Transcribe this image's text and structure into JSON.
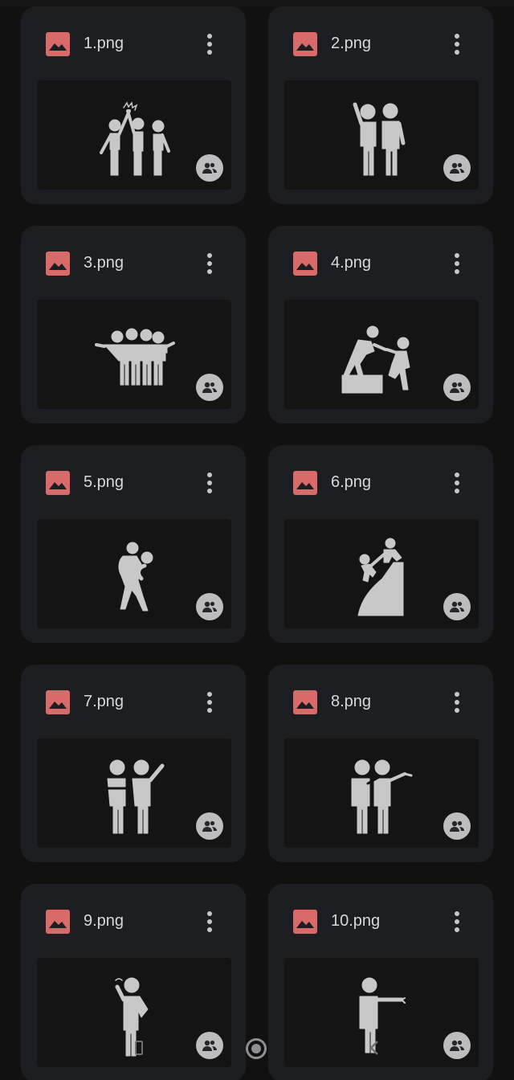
{
  "files": [
    {
      "name": "1.png",
      "illustration": "group-high-five-icon"
    },
    {
      "name": "2.png",
      "illustration": "two-friends-laughing-icon"
    },
    {
      "name": "3.png",
      "illustration": "group-hug-icon"
    },
    {
      "name": "4.png",
      "illustration": "helping-hand-step-icon"
    },
    {
      "name": "5.png",
      "illustration": "piggyback-ride-icon"
    },
    {
      "name": "6.png",
      "illustration": "climbing-help-icon"
    },
    {
      "name": "7.png",
      "illustration": "friends-arm-around-icon"
    },
    {
      "name": "8.png",
      "illustration": "friends-pointing-icon"
    },
    {
      "name": "9.png",
      "illustration": "person-thinking-icon"
    },
    {
      "name": "10.png",
      "illustration": "person-pointing-icon"
    }
  ],
  "icons": {
    "file_type": "image-file-icon",
    "more": "more-vert-icon",
    "shared": "shared-people-icon"
  },
  "colors": {
    "background": "#111112",
    "card": "#1d1e21",
    "thumbnail": "#141414",
    "file_icon": "#d86a6a",
    "text": "#d7d8dc",
    "illustration": "#c8c8c8",
    "badge": "#bdbdbf"
  },
  "system_nav": [
    "back-icon",
    "home-icon",
    "recents-icon"
  ]
}
